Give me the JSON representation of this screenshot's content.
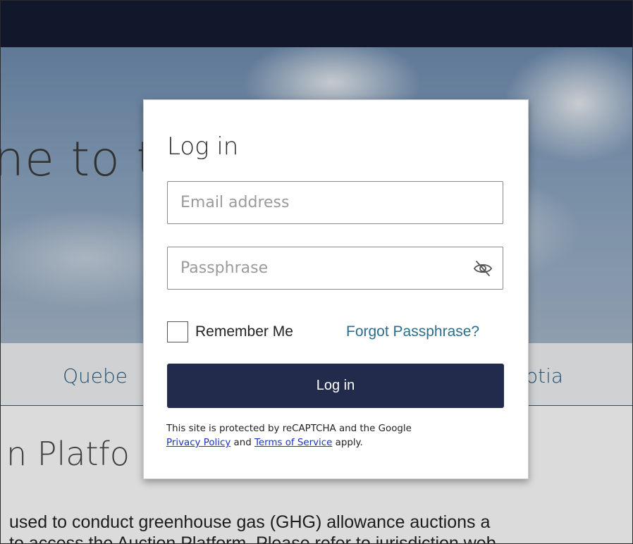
{
  "background": {
    "hero_title": "ne to t          tion i",
    "tabs": [
      "Quebe",
      "otia"
    ],
    "section_title": "n Platfo",
    "body_line_1": "used to conduct greenhouse gas (GHG) allowance auctions a",
    "body_line_2": "to access the Auction Platform. Please refer to jurisdiction web"
  },
  "login_modal": {
    "title": "Log in",
    "email_placeholder": "Email address",
    "passphrase_placeholder": "Passphrase",
    "toggle_visibility_icon": "eye-slash-icon",
    "remember_me_label": "Remember Me",
    "remember_me_checked": false,
    "forgot_link": "Forgot Passphrase?",
    "login_button": "Log in",
    "recaptcha": {
      "text_1": "This site is protected by reCAPTCHA and the Google",
      "privacy_link": "Privacy Policy",
      "text_2": "and",
      "terms_link": "Terms of Service",
      "text_3": "apply."
    }
  },
  "colors": {
    "topbar": "#151c33",
    "button": "#232b4d",
    "link": "#2c6d8c",
    "recaptcha_link": "#1a33c4"
  }
}
